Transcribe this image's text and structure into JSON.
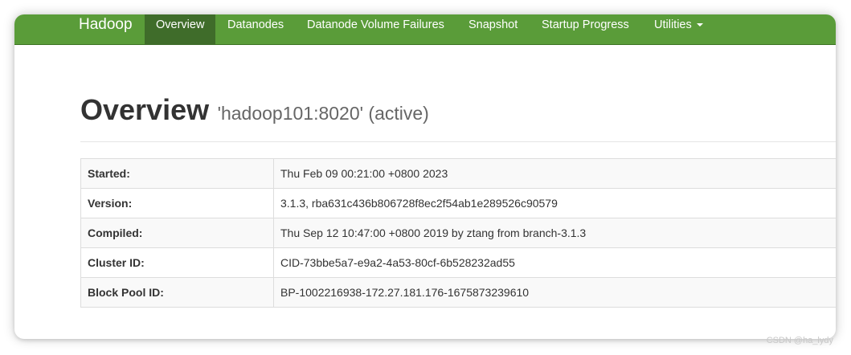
{
  "navbar": {
    "brand": "Hadoop",
    "items": [
      {
        "label": "Overview",
        "active": true
      },
      {
        "label": "Datanodes"
      },
      {
        "label": "Datanode Volume Failures"
      },
      {
        "label": "Snapshot"
      },
      {
        "label": "Startup Progress"
      },
      {
        "label": "Utilities",
        "dropdown": true
      }
    ],
    "color": "#5a9c39",
    "active_color": "#3f6c2a"
  },
  "header": {
    "title": "Overview",
    "subtitle": "'hadoop101:8020' (active)"
  },
  "info_table": [
    {
      "key": "Started:",
      "value": "Thu Feb 09 00:21:00 +0800 2023"
    },
    {
      "key": "Version:",
      "value": "3.1.3, rba631c436b806728f8ec2f54ab1e289526c90579"
    },
    {
      "key": "Compiled:",
      "value": "Thu Sep 12 10:47:00 +0800 2019 by ztang from branch-3.1.3"
    },
    {
      "key": "Cluster ID:",
      "value": "CID-73bbe5a7-e9a2-4a53-80cf-6b528232ad55"
    },
    {
      "key": "Block Pool ID:",
      "value": "BP-1002216938-172.27.181.176-1675873239610"
    }
  ],
  "watermark": "CSDN @ha_lydy"
}
